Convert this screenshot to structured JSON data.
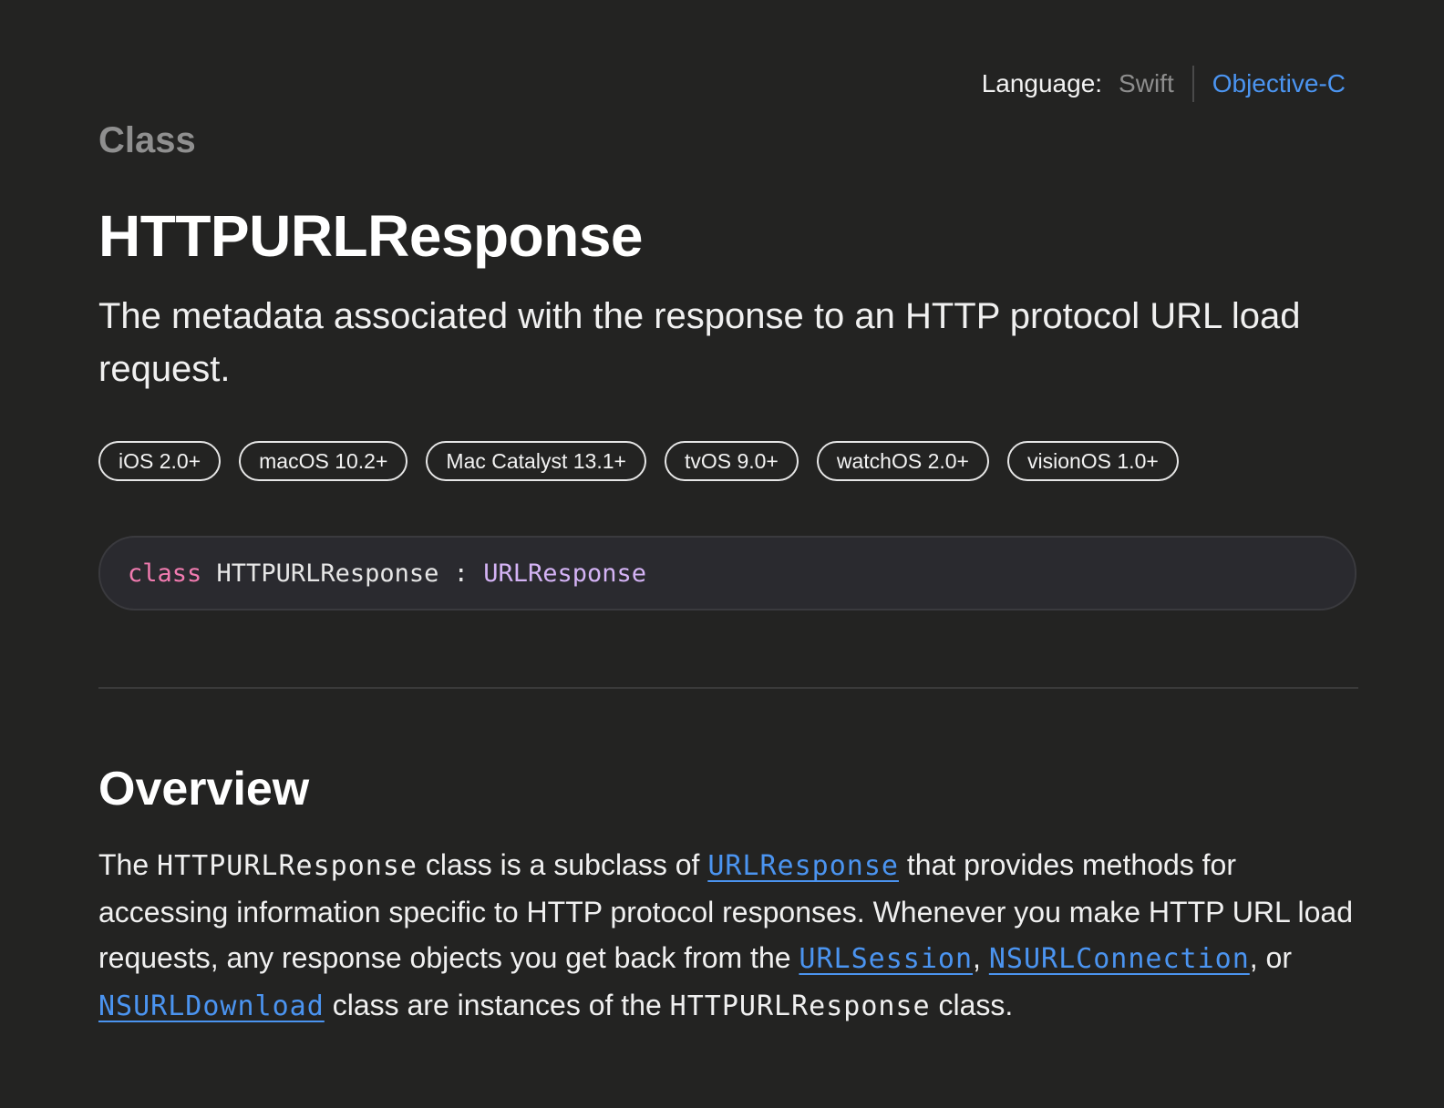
{
  "language_switch": {
    "label": "Language:",
    "options": [
      "Swift",
      "Objective-C"
    ],
    "selected": "Swift"
  },
  "header": {
    "eyebrow": "Class",
    "title": "HTTPURLResponse",
    "abstract": "The metadata associated with the response to an HTTP protocol URL load request."
  },
  "platforms": [
    "iOS 2.0+",
    "macOS 10.2+",
    "Mac Catalyst 13.1+",
    "tvOS 9.0+",
    "watchOS 2.0+",
    "visionOS 1.0+"
  ],
  "declaration": {
    "keyword": "class",
    "name": "HTTPURLResponse",
    "separator": ":",
    "superclass": "URLResponse"
  },
  "overview": {
    "heading": "Overview",
    "t1": "The ",
    "c1": "HTTPURLResponse",
    "t2": " class is a subclass of ",
    "l1": "URLResponse",
    "t3": " that provides methods for accessing information specific to HTTP protocol responses. Whenever you make HTTP URL load requests, any response objects you get back from the ",
    "l2": "URLSession",
    "t4": ", ",
    "l3": "NSURLConnection",
    "t5": ", or ",
    "l4": "NSURLDownload",
    "t6": " class are instances of the ",
    "c2": "HTTPURLResponse",
    "t7": " class."
  },
  "colors": {
    "background": "#232322",
    "link": "#4b94f0",
    "keyword": "#f17bb0",
    "type": "#d4b3f5"
  }
}
